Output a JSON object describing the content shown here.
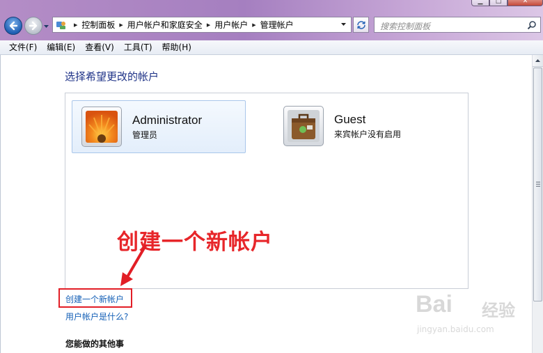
{
  "window": {
    "minimize_glyph": "▁",
    "maximize_glyph": "□",
    "close_glyph": "✕"
  },
  "address": {
    "crumbs": [
      "控制面板",
      "用户帐户和家庭安全",
      "用户帐户",
      "管理帐户"
    ]
  },
  "search": {
    "placeholder": "搜索控制面板"
  },
  "menubar": {
    "items": [
      "文件(F)",
      "编辑(E)",
      "查看(V)",
      "工具(T)",
      "帮助(H)"
    ]
  },
  "main": {
    "heading": "选择希望更改的帐户",
    "accounts": [
      {
        "name": "Administrator",
        "role": "管理员",
        "selected": true
      },
      {
        "name": "Guest",
        "role": "来宾帐户没有启用",
        "selected": false
      }
    ],
    "annotation": "创建一个新帐户",
    "links": {
      "create": "创建一个新帐户",
      "what": "用户帐户是什么?"
    },
    "other_title": "您能做的其他事"
  },
  "watermark": {
    "brand": "Bai",
    "cn": "经验",
    "url": "jingyan.baidu.com"
  },
  "colors": {
    "titlebar": "#b48dc6",
    "link": "#1560b7",
    "heading": "#1e3287",
    "annotation": "#e7262a"
  },
  "icons": [
    "back-arrow-icon",
    "forward-arrow-icon",
    "control-panel-icon",
    "refresh-icon",
    "search-icon",
    "administrator-flower-avatar",
    "guest-suitcase-avatar",
    "red-arrow-annotation"
  ]
}
